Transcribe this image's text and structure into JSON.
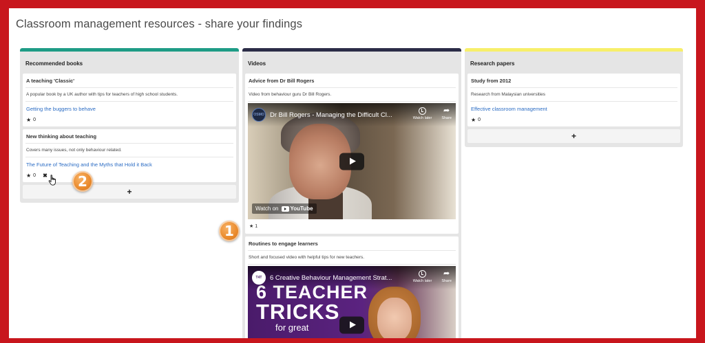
{
  "page": {
    "title": "Classroom management resources - share your findings"
  },
  "colors": {
    "frame": "#c8161d",
    "books_bar": "#1e9c86",
    "videos_bar": "#2b2c47",
    "papers_bar": "#f7ef6a",
    "link": "#2b6cc4",
    "callout": "#ea8a2c"
  },
  "columns": {
    "books": {
      "header": "Recommended books",
      "cards": [
        {
          "title": "A teaching 'Classic'",
          "desc": "A popular book by a UK author with tips for teachers of high school students.",
          "link": "Getting the buggers to behave",
          "stars": "0"
        },
        {
          "title": "New thinking about teaching",
          "desc": "Covers many issues, not only behaviour related.",
          "link": "The Future of Teaching and the Myths that Hold it Back",
          "stars": "0"
        }
      ],
      "add_label": "+"
    },
    "videos": {
      "header": "Videos",
      "cards": [
        {
          "title": "Advice from Dr Bill Rogers",
          "desc": "Video from behaviour guru Dr Bill Rogers.",
          "video_title": "Dr Bill Rogers - Managing the Difficult Cl...",
          "watch_later": "Watch later",
          "share": "Share",
          "watch_on": "Watch on",
          "youtube": "YouTube",
          "channel_badge": "OSMO",
          "stars": "1"
        },
        {
          "title": "Routines to engage learners",
          "desc": "Short and focused video with helpful tips for new teachers.",
          "video_title": "6 Creative Behaviour Management Strat...",
          "watch_later": "Watch later",
          "share": "Share",
          "channel_badge": "T4T",
          "thumb_line1": "6 TEACHER",
          "thumb_line2": "TRICKS",
          "thumb_line3": "for great",
          "thumb_logo": "T4T"
        }
      ]
    },
    "papers": {
      "header": "Research papers",
      "cards": [
        {
          "title": "Study from 2012",
          "desc": "Research from Malaysian universities",
          "link": "Effective classroom management",
          "stars": "0"
        }
      ],
      "add_label": "+"
    }
  },
  "callouts": {
    "one": "1",
    "two": "2"
  },
  "icons": {
    "star": "★",
    "delete": "✖",
    "share": "➦"
  }
}
